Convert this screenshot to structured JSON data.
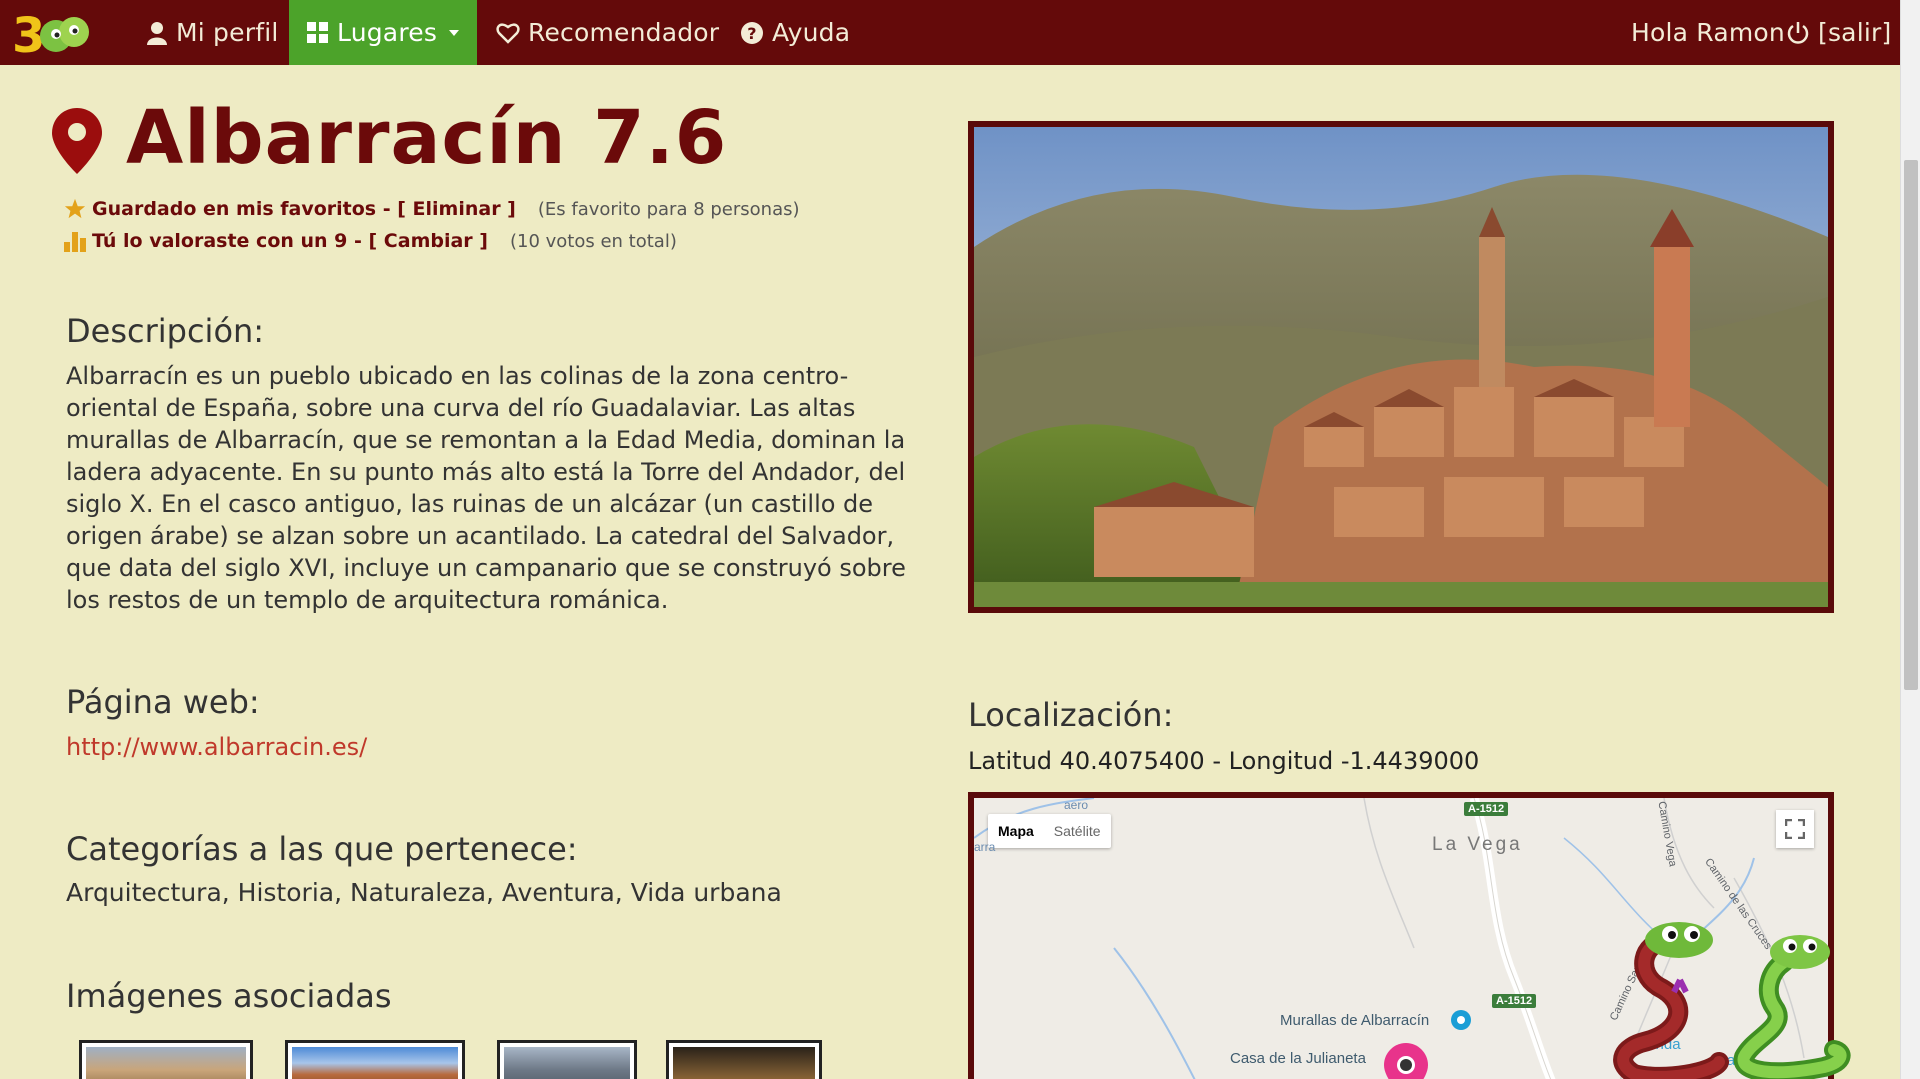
{
  "nav": {
    "logo_text": "3",
    "items": [
      {
        "label": "Mi perfil",
        "icon": "user-icon"
      },
      {
        "label": "Lugares",
        "icon": "grid-icon"
      },
      {
        "label": "Recomendador",
        "icon": "heart-icon"
      },
      {
        "label": "Ayuda",
        "icon": "question-icon"
      }
    ],
    "greeting": "Hola Ramon",
    "logout": "[salir]"
  },
  "place": {
    "name": "Albarracín",
    "score": "7.6",
    "favorite_text": "Guardado en mis favoritos - [ Eliminar ]",
    "favorite_count": "(Es favorito para 8 personas)",
    "rating_text": "Tú lo valoraste con un 9 - [ Cambiar ]",
    "votes_total": "(10 votos en total)",
    "description_heading": "Descripción:",
    "description": "Albarracín es un pueblo ubicado en las colinas de la zona centro-oriental de España, sobre una curva del río Guadalaviar. Las altas murallas de Albarracín, que se remontan a la Edad Media, dominan la ladera adyacente. En su punto más alto está la Torre del Andador, del siglo X. En el casco antiguo, las ruinas de un alcázar (un castillo de origen árabe) se alzan sobre un acantilado. La catedral del Salvador, que data del siglo XVI, incluye un campanario que se construyó sobre los restos de un templo de arquitectura románica.",
    "web_heading": "Página web:",
    "web_url": "http://www.albarracin.es/",
    "categories_heading": "Categorías a las que pertenece:",
    "categories": "Arquitectura, Historia, Naturaleza, Aventura, Vida urbana",
    "images_heading": "Imágenes asociadas"
  },
  "location": {
    "heading": "Localización:",
    "coords": "Latitud 40.4075400 - Longitud -1.4439000"
  },
  "map": {
    "type_map": "Mapa",
    "type_satellite": "Satélite",
    "labels": {
      "la_vega": "La Vega",
      "murallas": "Murallas de Albarracín",
      "julianeta": "Casa de la Julianeta",
      "road1": "A-1512",
      "road2": "A-1512",
      "camino_vega": "Camino Vega",
      "camino_cruces": "Camino de las Cruces",
      "camino_santo": "Camino Santo Cristo",
      "fund": "Funda",
      "cas": "Cas",
      "arra": "arra",
      "aero": "aero"
    }
  },
  "colors": {
    "navbar": "#640a0a",
    "active_tab": "#4ca32a",
    "page_bg": "#eeebc4",
    "accent": "#6b0a0a",
    "link": "#c0392b"
  }
}
